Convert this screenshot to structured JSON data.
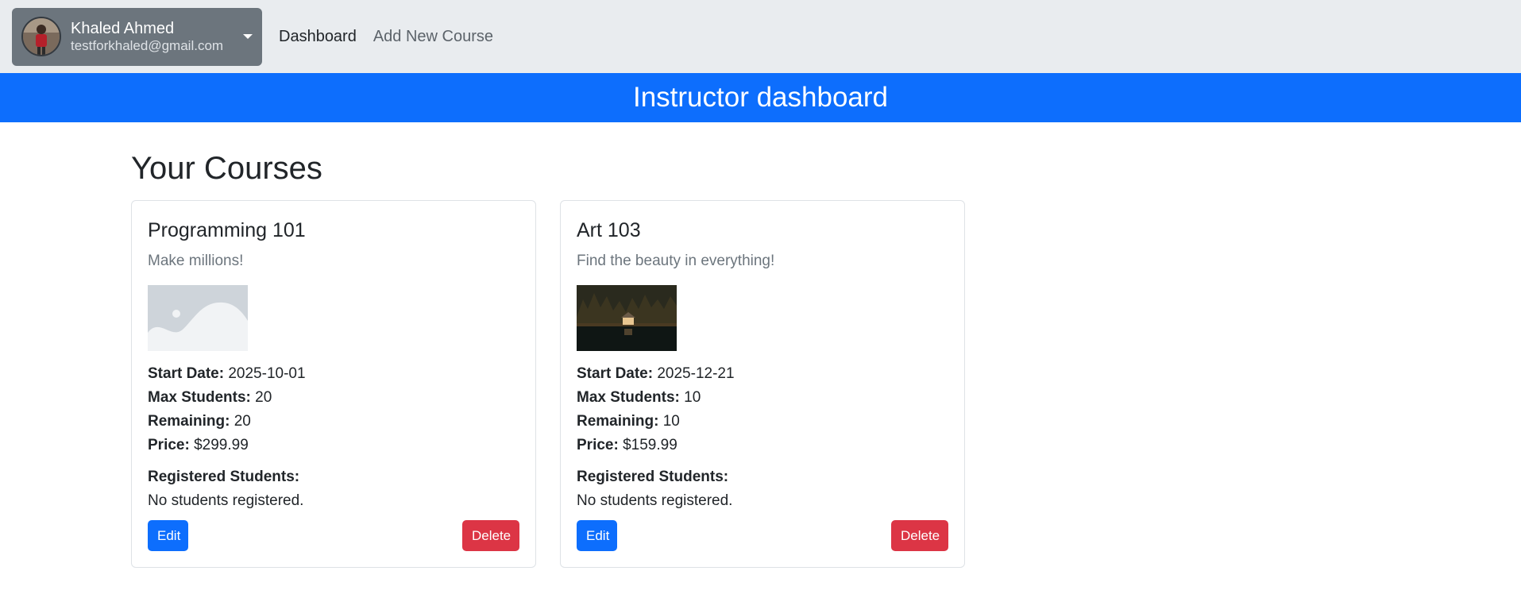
{
  "navbar": {
    "user": {
      "name": "Khaled Ahmed",
      "email": "testforkhaled@gmail.com"
    },
    "links": [
      {
        "label": "Dashboard",
        "active": true
      },
      {
        "label": "Add New Course",
        "active": false
      }
    ]
  },
  "banner": {
    "title": "Instructor dashboard"
  },
  "main": {
    "title": "Your Courses",
    "courses": [
      {
        "title": "Programming 101",
        "description": "Make millions!",
        "image": "placeholder-image-icon",
        "start_date_label": "Start Date:",
        "start_date": "2025-10-01",
        "max_students_label": "Max Students:",
        "max_students": "20",
        "remaining_label": "Remaining:",
        "remaining": "20",
        "price_label": "Price:",
        "price": "$299.99",
        "registered_label": "Registered Students:",
        "registered_text": "No students registered.",
        "edit_label": "Edit",
        "delete_label": "Delete"
      },
      {
        "title": "Art 103",
        "description": "Find the beauty in everything!",
        "image": "lake-cabin-photo",
        "start_date_label": "Start Date:",
        "start_date": "2025-12-21",
        "max_students_label": "Max Students:",
        "max_students": "10",
        "remaining_label": "Remaining:",
        "remaining": "10",
        "price_label": "Price:",
        "price": "$159.99",
        "registered_label": "Registered Students:",
        "registered_text": "No students registered.",
        "edit_label": "Edit",
        "delete_label": "Delete"
      }
    ]
  },
  "colors": {
    "navbar_bg": "#e9ecef",
    "dropdown_bg": "#6c757d",
    "banner_bg": "#0d6efd",
    "edit_btn": "#0d6efd",
    "delete_btn": "#dc3545"
  }
}
